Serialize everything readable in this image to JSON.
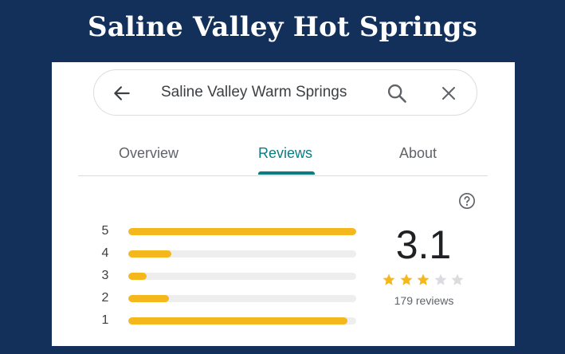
{
  "banner": {
    "title": "Saline Valley Hot Springs"
  },
  "search": {
    "query": "Saline Valley Warm Springs"
  },
  "tabs": [
    {
      "label": "Overview",
      "active": false
    },
    {
      "label": "Reviews",
      "active": true
    },
    {
      "label": "About",
      "active": false
    }
  ],
  "rating_distribution": [
    {
      "stars": "5",
      "fraction": 1.0
    },
    {
      "stars": "4",
      "fraction": 0.19
    },
    {
      "stars": "3",
      "fraction": 0.08
    },
    {
      "stars": "2",
      "fraction": 0.18
    },
    {
      "stars": "1",
      "fraction": 0.96
    }
  ],
  "summary": {
    "average": "3.1",
    "star_fill": 3,
    "star_total": 5,
    "review_count": "179 reviews"
  },
  "colors": {
    "background": "#12305a",
    "accent_teal": "#0b7c81",
    "bar_fill": "#f5b81c",
    "bar_track": "#eeeeee",
    "star_empty": "#dadce0"
  },
  "icons": {
    "back": "arrow-left",
    "search": "magnifier",
    "close": "x",
    "help": "question-circle"
  }
}
